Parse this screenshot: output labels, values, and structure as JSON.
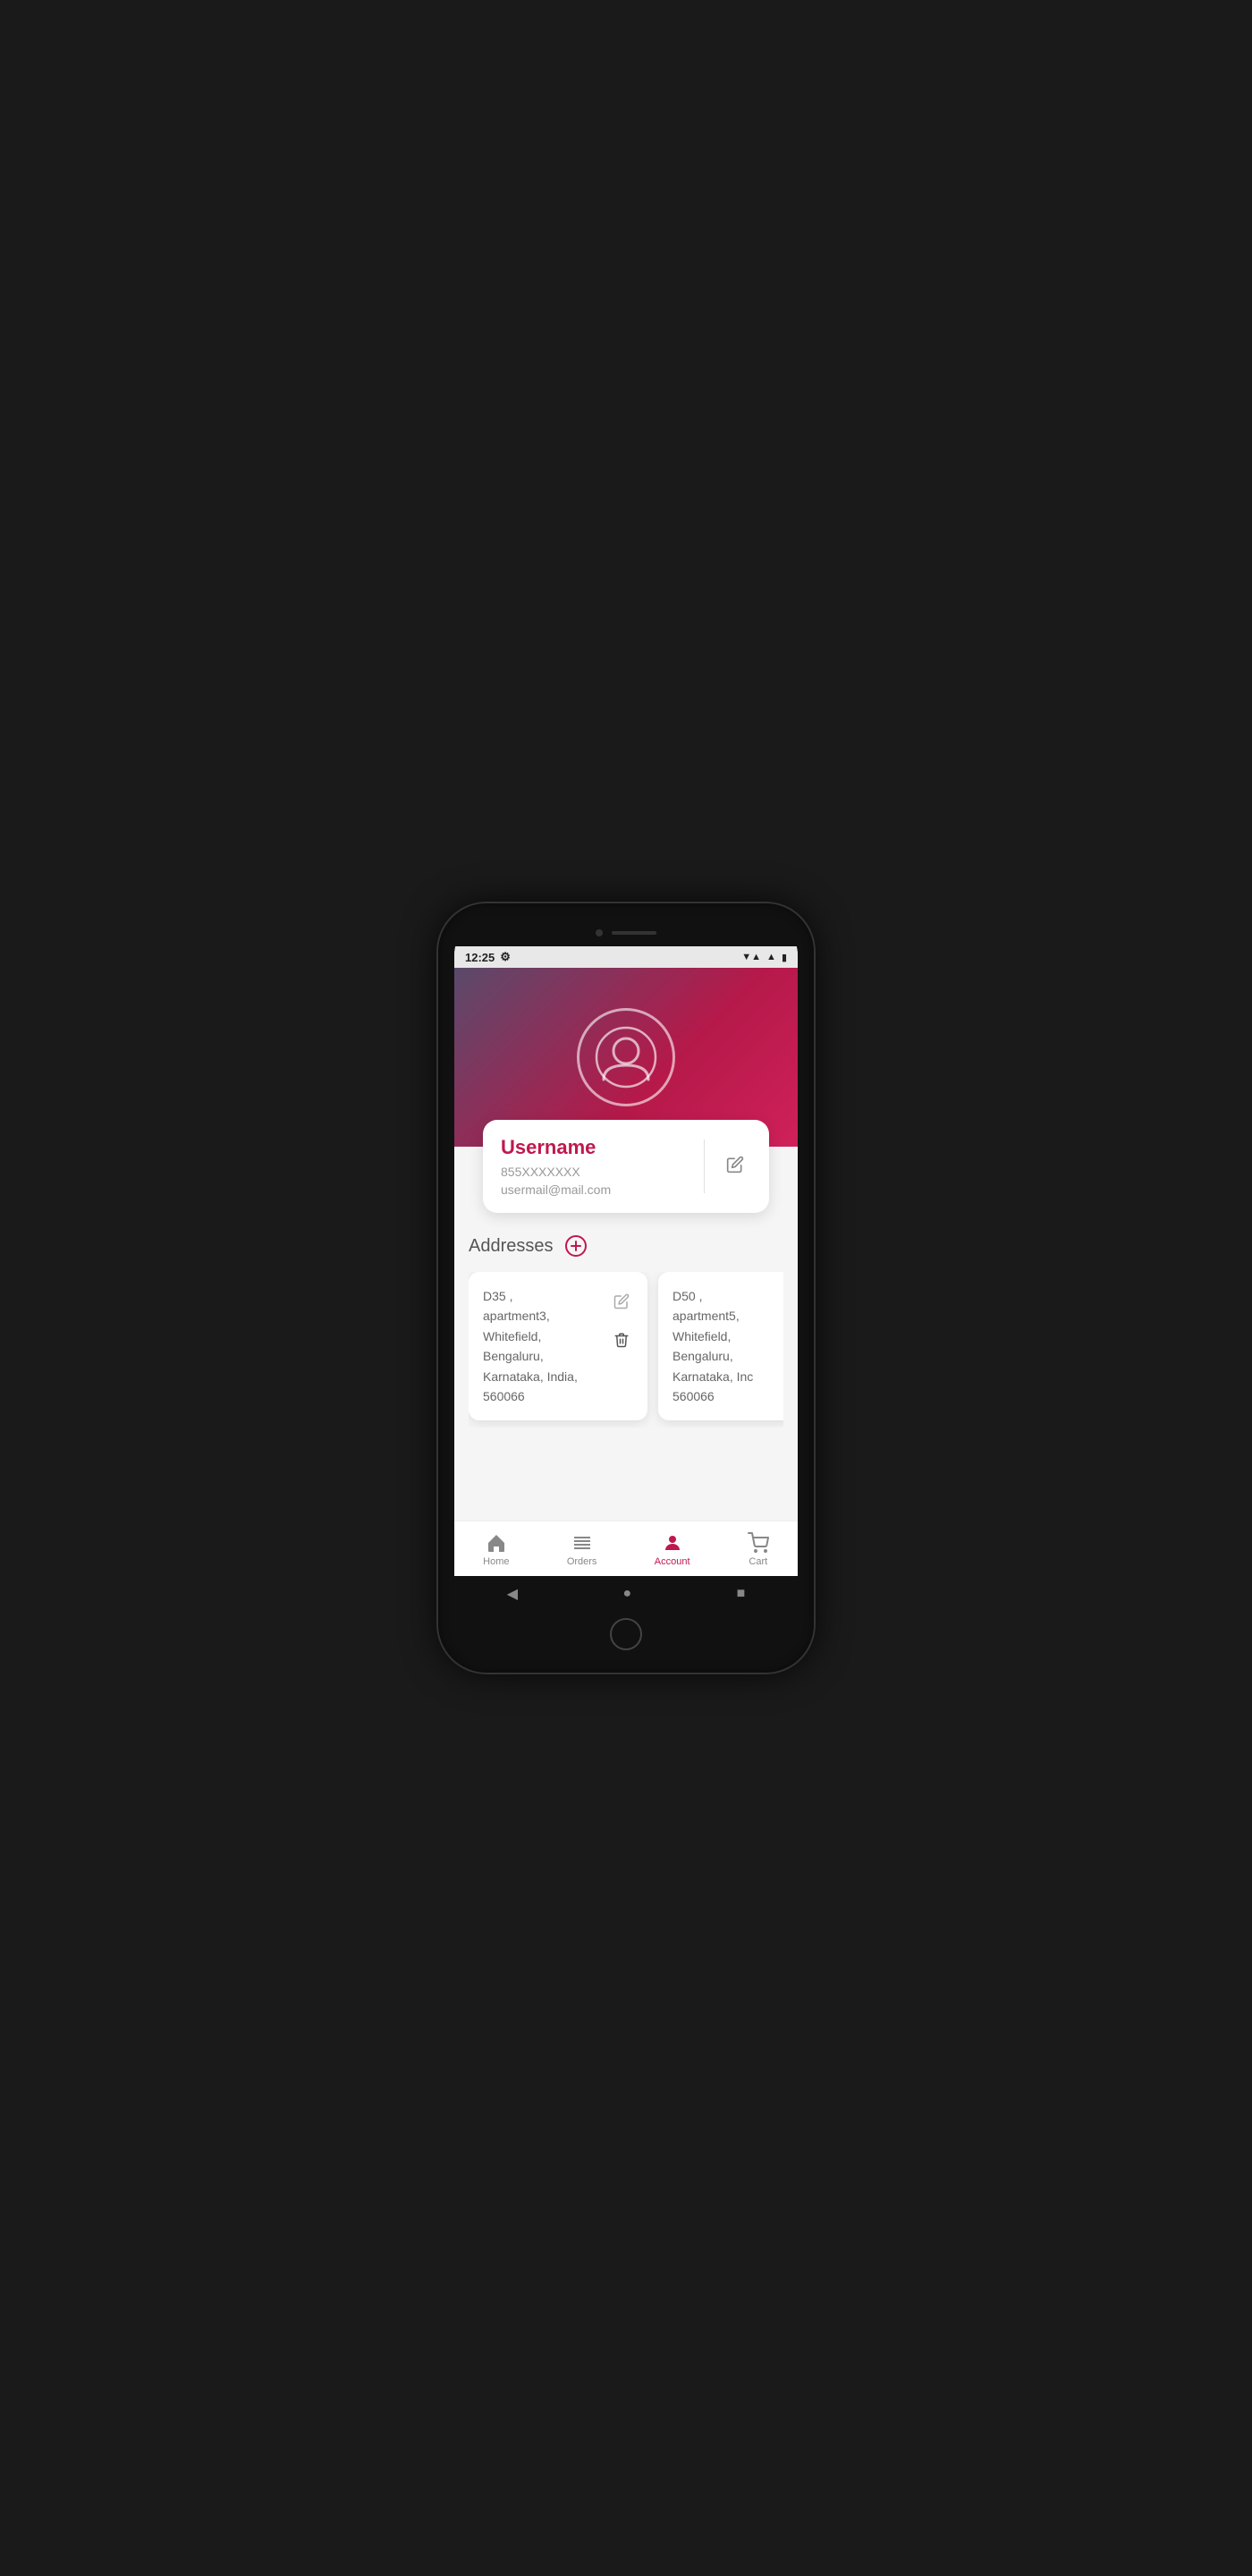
{
  "status_bar": {
    "time": "12:25",
    "wifi_icon": "wifi",
    "signal_icon": "signal",
    "battery_icon": "battery"
  },
  "profile": {
    "avatar_label": "user avatar",
    "username": "Username",
    "phone": "855XXXXXXX",
    "email": "usermail@mail.com",
    "edit_icon": "✏"
  },
  "addresses": {
    "section_title": "Addresses",
    "add_icon": "+",
    "items": [
      {
        "id": 1,
        "text": "D35 ,\napartment3,\nWhitefield,\nBengaluru,\nKarnataka, India,\n560066"
      },
      {
        "id": 2,
        "text": "D50 ,\napartment5,\nWhitefield,\nBengaluru,\nKarnataka, Inc\n560066"
      }
    ]
  },
  "bottom_nav": {
    "items": [
      {
        "id": "home",
        "label": "Home",
        "active": false
      },
      {
        "id": "orders",
        "label": "Orders",
        "active": false
      },
      {
        "id": "account",
        "label": "Account",
        "active": true
      },
      {
        "id": "cart",
        "label": "Cart",
        "active": false
      }
    ]
  },
  "android_nav": {
    "back": "◀",
    "home": "●",
    "recent": "■"
  }
}
